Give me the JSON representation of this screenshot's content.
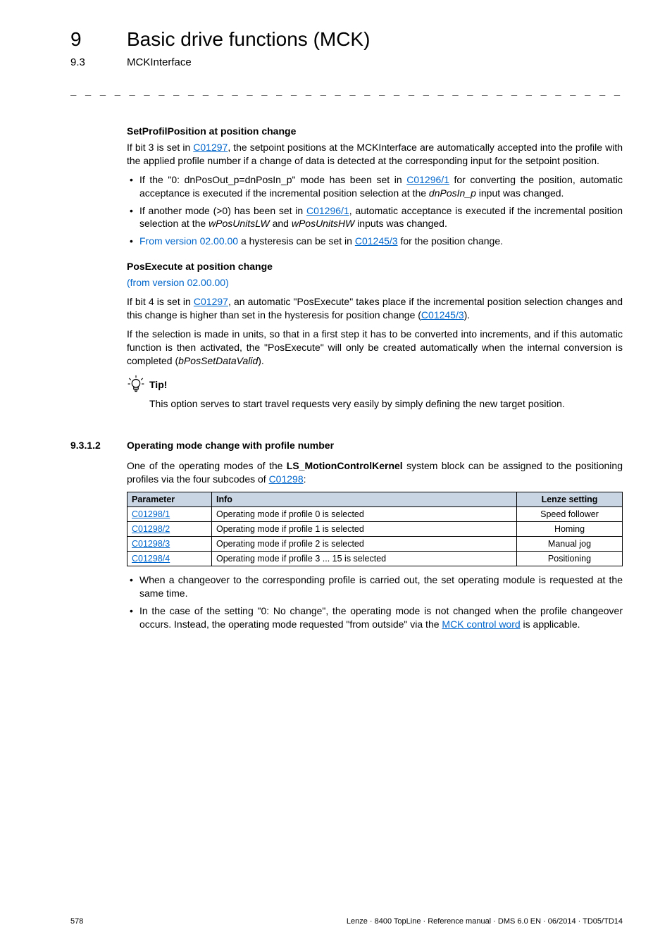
{
  "header": {
    "chapnum": "9",
    "chaptitle": "Basic drive functions (MCK)",
    "secnum": "9.3",
    "sectitle": "MCKInterface",
    "dashes": "_ _ _ _ _ _ _ _ _ _ _ _ _ _ _ _ _ _ _ _ _ _ _ _ _ _ _ _ _ _ _ _ _ _ _ _ _ _ _ _ _ _ _ _ _ _ _ _ _ _ _ _ _ _ _ _ _ _ _ _ _ _ _ _"
  },
  "sec1": {
    "heading": "SetProfilPosition at position change",
    "p1_a": "If bit 3 is set in ",
    "p1_link1": "C01297",
    "p1_b": ", the setpoint positions at the MCKInterface are automatically accepted into the profile with the applied profile number if a change of data is detected at the corresponding input for the setpoint position.",
    "li1_a": "If the \"0: dnPosOut_p=dnPosIn_p\" mode has been set in ",
    "li1_link": "C01296/1",
    "li1_b": " for converting the position, automatic acceptance is executed if the incremental position selection at the ",
    "li1_it": "dnPosIn_p",
    "li1_c": " input was changed.",
    "li2_a": "If another mode (>0) has been set in ",
    "li2_link": "C01296/1",
    "li2_b": ", automatic acceptance is executed if the incremental position selection at the ",
    "li2_it1": "wPosUnitsLW",
    "li2_mid": " and ",
    "li2_it2": "wPosUnitsHW",
    "li2_c": " inputs was changed.",
    "li3_ver": "From version 02.00.00",
    "li3_a": " a hysteresis can be set in ",
    "li3_link": "C01245/3",
    "li3_b": " for the position change."
  },
  "sec2": {
    "heading": "PosExecute at position change",
    "version": "(from version 02.00.00)",
    "p1_a": "If bit 4 is set in ",
    "p1_link1": "C01297",
    "p1_b": ", an automatic \"PosExecute\" takes place if the incremental position selection changes and this change is higher than set in the hysteresis for position change (",
    "p1_link2": "C01245/3",
    "p1_c": ").",
    "p2_a": "If the selection is made in units, so that in a first step it has to be converted into increments, and if this automatic function is then activated, the \"PosExecute\" will only be created automatically when the internal conversion is completed (",
    "p2_it": "bPosSetDataValid",
    "p2_b": ")."
  },
  "tip": {
    "label": "Tip!",
    "text": "This option serves to start travel requests very easily by simply defining the new target position."
  },
  "subsec": {
    "num": "9.3.1.2",
    "title": "Operating mode change with profile number",
    "intro_a": "One of the operating modes of the ",
    "intro_bold": "LS_MotionControlKernel",
    "intro_b": " system block can be assigned to the positioning profiles via the four subcodes of ",
    "intro_link": "C01298",
    "intro_c": ":"
  },
  "table": {
    "headers": {
      "c1": "Parameter",
      "c2": "Info",
      "c3": "Lenze setting"
    },
    "rows": [
      {
        "param": "C01298/1",
        "info": "Operating mode if profile 0 is selected",
        "setting": "Speed follower"
      },
      {
        "param": "C01298/2",
        "info": "Operating mode if profile 1 is selected",
        "setting": "Homing"
      },
      {
        "param": "C01298/3",
        "info": "Operating mode if profile 2 is selected",
        "setting": "Manual jog"
      },
      {
        "param": "C01298/4",
        "info": "Operating mode if profile 3 ... 15 is selected",
        "setting": "Positioning"
      }
    ]
  },
  "after": {
    "li1": "When a changeover to the corresponding profile is carried out, the set operating module is requested at the same time.",
    "li2_a": "In the case of the setting \"0: No change\", the operating mode is not changed when the profile changeover occurs. Instead, the operating mode requested \"from outside\" via the ",
    "li2_link": "MCK control word",
    "li2_b": " is applicable."
  },
  "footer": {
    "page": "578",
    "right": "Lenze · 8400 TopLine · Reference manual · DMS 6.0 EN · 06/2014 · TD05/TD14"
  }
}
